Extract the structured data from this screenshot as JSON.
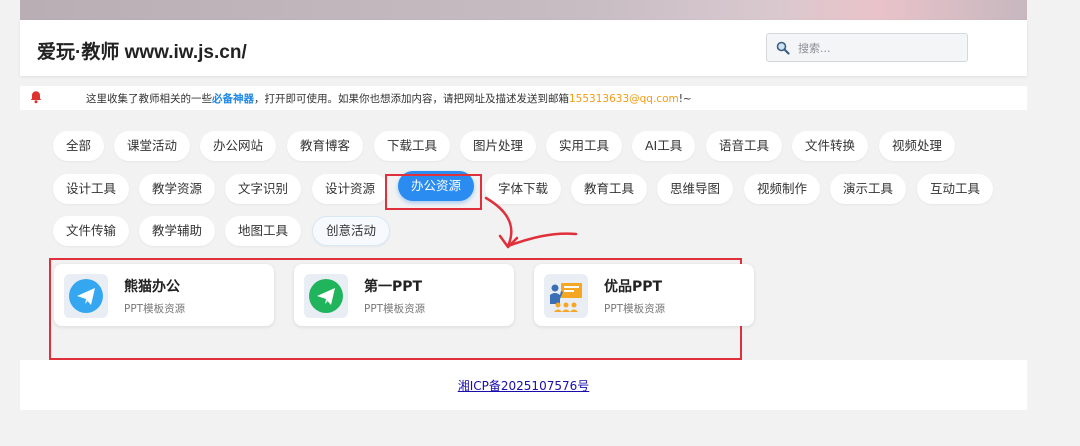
{
  "header": {
    "site_title": "爱玩·教师 www.iw.js.cn/",
    "search_placeholder": "搜索..."
  },
  "notice": {
    "text_before": "这里收集了教师相关的一些",
    "highlight": "必备神器",
    "text_middle": "，打开即可使用。如果你也想添加内容，请把网址及描述发送到邮箱",
    "email": "155313633@qq.com",
    "text_after": "!~"
  },
  "categories": {
    "row1": [
      "全部",
      "课堂活动",
      "办公网站",
      "教育博客",
      "下载工具",
      "图片处理",
      "实用工具",
      "AI工具",
      "语音工具",
      "文件转换",
      "视频处理"
    ],
    "row2": [
      "设计工具",
      "教学资源",
      "文字识别",
      "设计资源",
      "办公资源",
      "字体下载",
      "教育工具",
      "思维导图",
      "视频制作",
      "演示工具",
      "互动工具"
    ],
    "row3": [
      "文件传输",
      "教学辅助",
      "地图工具",
      "创意活动"
    ],
    "active": "办公资源"
  },
  "cards": [
    {
      "name": "熊猫办公",
      "desc": "PPT模板资源",
      "icon": "paper-plane-icon",
      "color": "#35a7f0"
    },
    {
      "name": "第一PPT",
      "desc": "PPT模板资源",
      "icon": "paper-plane-icon",
      "color": "#20b45c"
    },
    {
      "name": "优品PPT",
      "desc": "PPT模板资源",
      "icon": "presenter-board-icon",
      "color": "#f5a623"
    }
  ],
  "footer": {
    "icp": "湘ICP备2025107576号"
  },
  "colors": {
    "accent": "#2a8bf0",
    "annotation_red": "#e0303c"
  }
}
